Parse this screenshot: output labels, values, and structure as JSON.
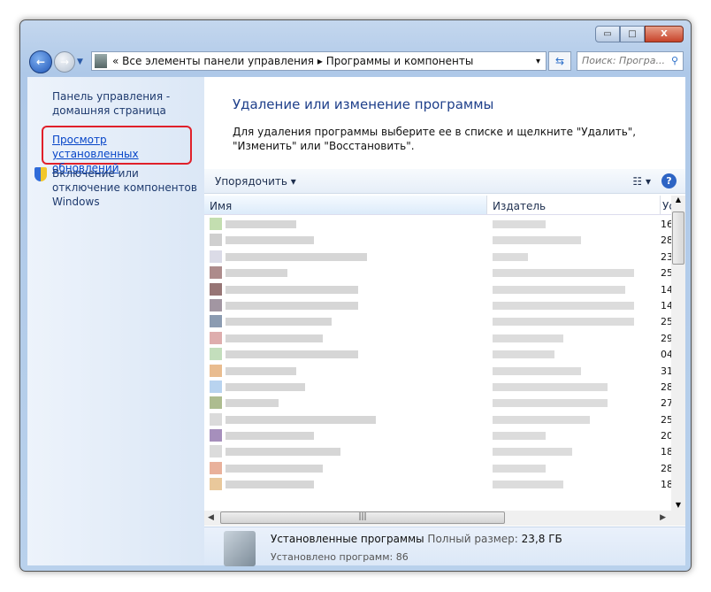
{
  "window": {
    "minimize": "▭",
    "maximize": "□",
    "close": "X"
  },
  "address": {
    "chevrons": "«",
    "crumb1": "Все элементы панели управления",
    "sep": "▸",
    "crumb2": "Программы и компоненты",
    "dropdown": "▾"
  },
  "search": {
    "placeholder": "Поиск: Програ...",
    "icon": "search-icon"
  },
  "sidebar": {
    "home": "Панель управления - домашняя страница",
    "updates": "Просмотр установленных обновлений",
    "features": "Включение или отключение компонентов Windows"
  },
  "main": {
    "title": "Удаление или изменение программы",
    "description": "Для удаления программы выберите ее в списке и щелкните \"Удалить\", \"Изменить\" или \"Восстановить\".",
    "toolbar": {
      "organize": "Упорядочить ▾",
      "views": "☷ ▾",
      "help": "?"
    },
    "columns": [
      "Имя",
      "Издатель",
      "Ус"
    ],
    "dates": [
      "16",
      "28",
      "23",
      "25",
      "14",
      "14",
      "25",
      "29",
      "04",
      "31",
      "28",
      "27",
      "25",
      "20",
      "18",
      "28",
      "18"
    ]
  },
  "status": {
    "title": "Установленные программы",
    "size_label": "Полный размер:",
    "size": "23,8 ГБ",
    "count": "Установлено программ: 86"
  }
}
